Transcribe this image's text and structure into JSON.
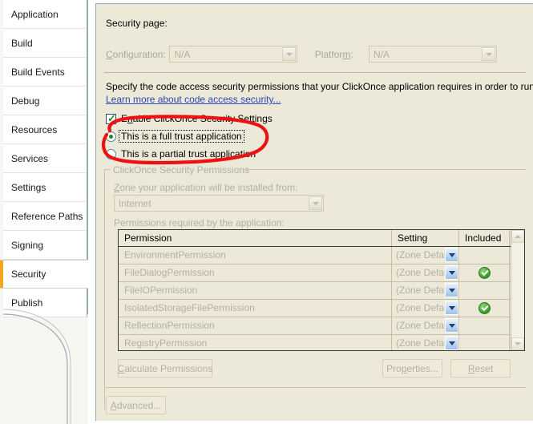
{
  "sidebar": {
    "items": [
      {
        "label": "Application",
        "selected": false
      },
      {
        "label": "Build",
        "selected": false
      },
      {
        "label": "Build Events",
        "selected": false
      },
      {
        "label": "Debug",
        "selected": false
      },
      {
        "label": "Resources",
        "selected": false
      },
      {
        "label": "Services",
        "selected": false
      },
      {
        "label": "Settings",
        "selected": false
      },
      {
        "label": "Reference Paths",
        "selected": false
      },
      {
        "label": "Signing",
        "selected": false
      },
      {
        "label": "Security",
        "selected": true
      },
      {
        "label": "Publish",
        "selected": false
      }
    ],
    "accent_color": "#f0a818"
  },
  "page": {
    "title": "Security page:",
    "configuration_label": "Configuration:",
    "configuration_value": "N/A",
    "platform_label": "Platform:",
    "platform_value": "N/A",
    "description": "Specify the code access security permissions that your ClickOnce application requires in order to run.",
    "learn_more_link": "Learn more about code access security...",
    "enable_checkbox_label": "Enable ClickOnce Security Settings",
    "enable_checkbox_checked": true,
    "trust_options": [
      {
        "label": "This is a full trust application",
        "selected": true,
        "focused": true
      },
      {
        "label": "This is a partial trust application",
        "selected": false,
        "focused": false
      }
    ]
  },
  "permissions_group": {
    "caption": "ClickOnce Security Permissions",
    "zone_label": "Zone your application will be installed from:",
    "zone_value": "Internet",
    "permissions_label": "Permissions required by the application:"
  },
  "grid": {
    "columns": [
      "Permission",
      "Setting",
      "Included"
    ],
    "rows": [
      {
        "permission": "EnvironmentPermission",
        "setting": "(Zone Default)",
        "included": false
      },
      {
        "permission": "FileDialogPermission",
        "setting": "(Zone Default)",
        "included": true
      },
      {
        "permission": "FileIOPermission",
        "setting": "(Zone Default)",
        "included": false
      },
      {
        "permission": "IsolatedStorageFilePermission",
        "setting": "(Zone Default)",
        "included": true
      },
      {
        "permission": "ReflectionPermission",
        "setting": "(Zone Default)",
        "included": false
      },
      {
        "permission": "RegistryPermission",
        "setting": "(Zone Default)",
        "included": false
      }
    ]
  },
  "buttons": {
    "calculate": "Calculate Permissions",
    "properties": "Properties...",
    "reset": "Reset",
    "advanced": "Advanced..."
  },
  "annotation": {
    "color": "#ee1111",
    "shape": "hand-drawn-ellipse",
    "targets": "trust application radio buttons"
  }
}
